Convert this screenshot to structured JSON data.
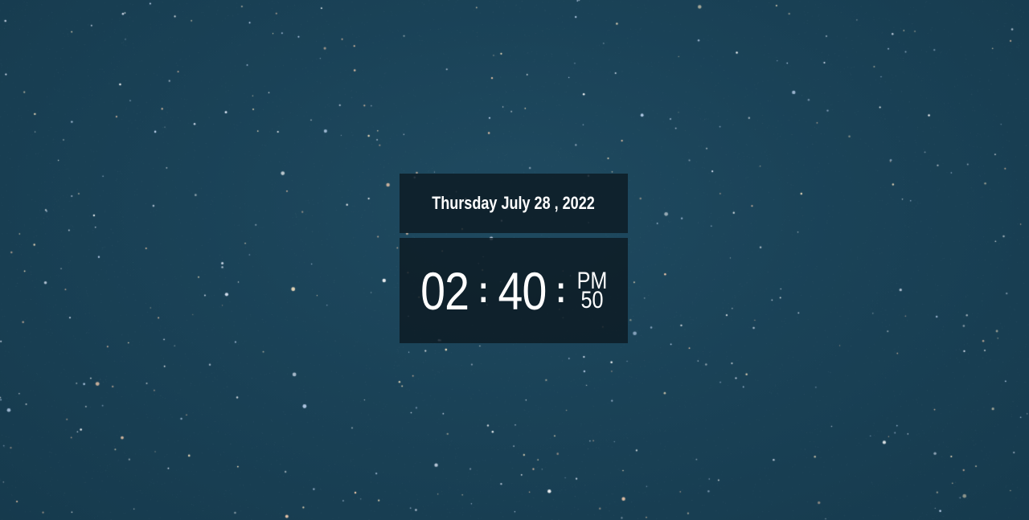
{
  "background": {
    "name": "starry-night-sky",
    "colors": {
      "base": "#1a4257",
      "panel": "#0c1a22",
      "text": "#ffffff"
    }
  },
  "clock": {
    "date": "Thursday July 28 , 2022",
    "hours": "02",
    "minutes": "40",
    "separator": ":",
    "meridiem": "PM",
    "seconds": "50"
  }
}
